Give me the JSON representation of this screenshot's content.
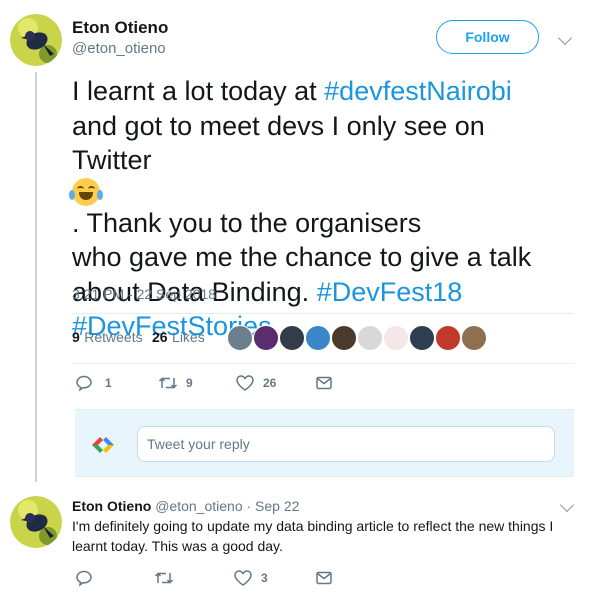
{
  "author": {
    "name": "Eton Otieno",
    "handle": "@eton_otieno",
    "follow_label": "Follow"
  },
  "tweet": {
    "line1": [
      "I learnt a lot today at ",
      "#devfestNairobi"
    ],
    "line2": "and got to meet devs I only see on",
    "line3": [
      "Twitter ",
      ". Thank you to the organisers"
    ],
    "line4": "who gave me the chance to give a talk",
    "line5": [
      "about Data Binding. ",
      "#DevFest18"
    ],
    "line6": "#DevFestStories",
    "timestamp": "3:21 PM - 22 Sep 2018",
    "retweets_count": "9",
    "retweets_label": "Retweets",
    "likes_count": "26",
    "likes_label": "Likes",
    "actions": {
      "replies": "1",
      "retweets": "9",
      "likes": "26"
    }
  },
  "reply_composer": {
    "placeholder": "Tweet your reply"
  },
  "reply": {
    "name": "Eton Otieno",
    "handle": "@eton_otieno",
    "date": "· Sep 22",
    "text_line1": "I'm definitely going to update my data binding article to reflect the new things I",
    "text_line2": "learnt today. This was a good day.",
    "actions": {
      "replies": "",
      "retweets": "",
      "likes": "3"
    }
  },
  "colors": {
    "accent": "#1da1f2",
    "hashtag": "#1b95e0",
    "muted": "#657786",
    "text": "#14171a",
    "divider": "#e6ecf0"
  }
}
